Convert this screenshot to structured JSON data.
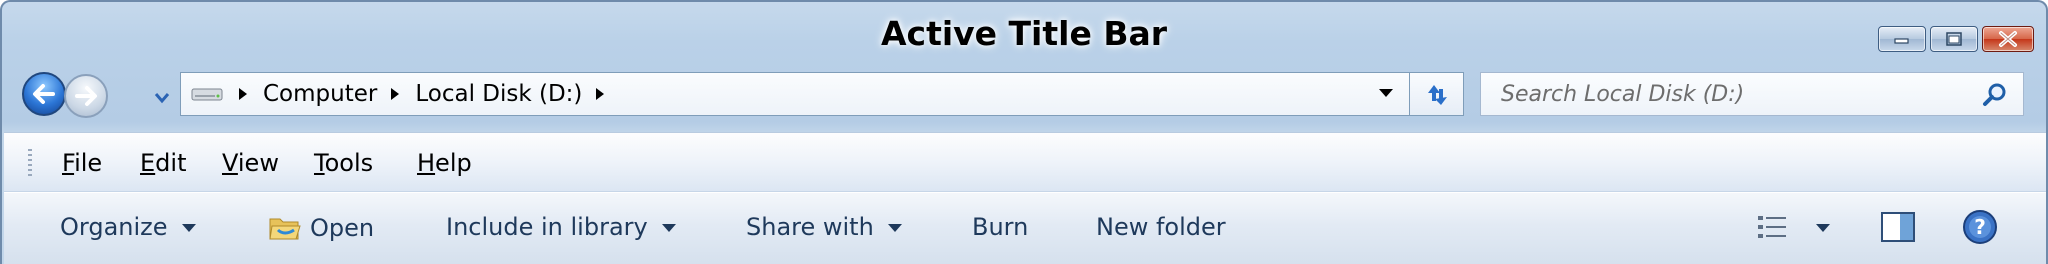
{
  "window": {
    "title": "Active Title Bar"
  },
  "caption_buttons": {
    "minimize": "minimize-icon",
    "maximize": "maximize-icon",
    "close": "close-icon"
  },
  "navigation": {
    "back": "back-arrow-icon",
    "forward": "forward-arrow-icon",
    "recent": "chevron-down-icon"
  },
  "address": {
    "crumbs": [
      "Computer",
      "Local Disk (D:)"
    ],
    "drive_icon": "drive-icon"
  },
  "search": {
    "placeholder": "Search Local Disk (D:)"
  },
  "menu": {
    "items": [
      {
        "accel": "F",
        "rest": "ile"
      },
      {
        "accel": "E",
        "rest": "dit"
      },
      {
        "accel": "V",
        "rest": "iew"
      },
      {
        "accel": "T",
        "rest": "ools"
      },
      {
        "accel": "H",
        "rest": "elp"
      }
    ]
  },
  "commands": {
    "organize": "Organize",
    "open": "Open",
    "include_library": "Include in library",
    "share_with": "Share with",
    "burn": "Burn",
    "new_folder": "New folder"
  },
  "colors": {
    "title_bg": "#bad1e8",
    "close_red": "#c5371a",
    "command_text": "#1e395b",
    "border": "#7f9db9"
  }
}
